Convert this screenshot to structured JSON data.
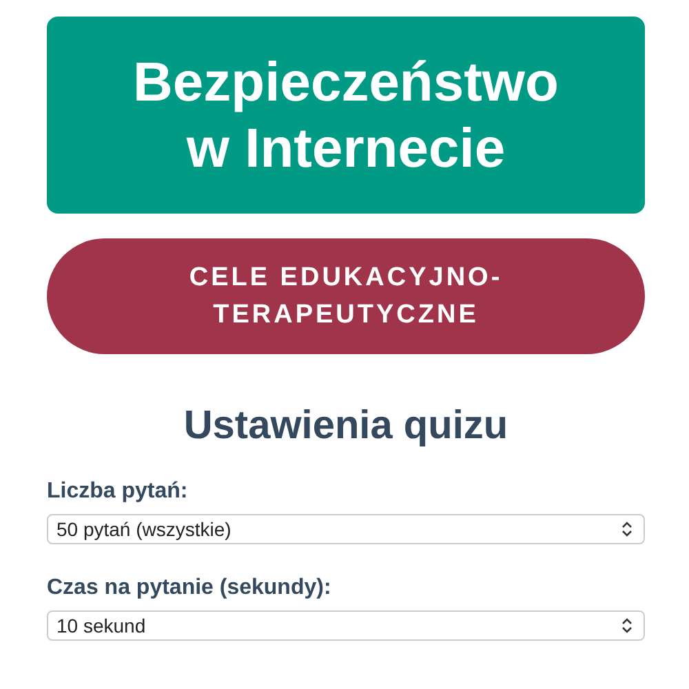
{
  "header": {
    "title": "Bezpieczeństwo w Internecie"
  },
  "goals_button": {
    "label": "CELE EDUKACYJNO-TERAPEUTYCZNE"
  },
  "settings": {
    "heading": "Ustawienia quizu",
    "fields": [
      {
        "label": "Liczba pytań:",
        "value": "50 pytań (wszystkie)"
      },
      {
        "label": "Czas na pytanie (sekundy):",
        "value": "10 sekund"
      }
    ]
  }
}
